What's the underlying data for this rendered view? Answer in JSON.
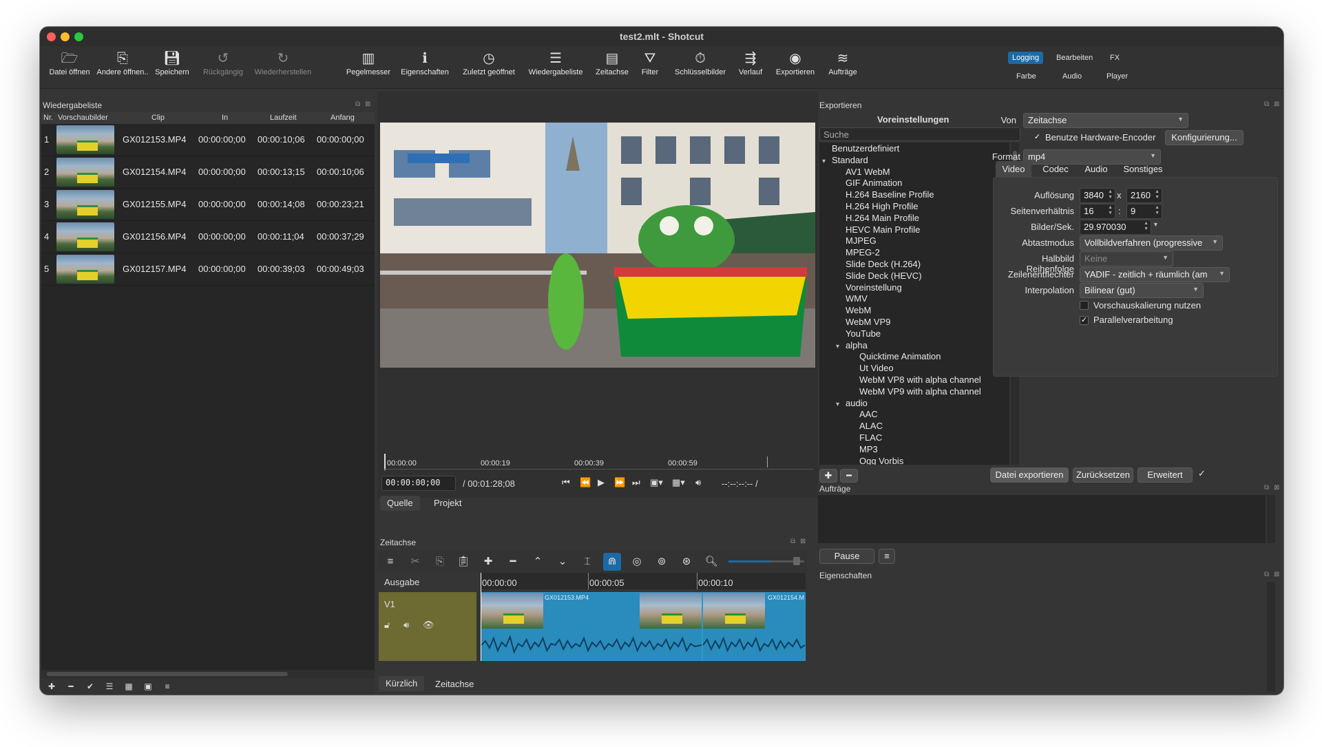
{
  "window": {
    "title": "test2.mlt - Shotcut"
  },
  "toolbar": {
    "items": [
      {
        "label": "Datei öffnen",
        "icon": "folder-open-icon"
      },
      {
        "label": "Andere öffnen..",
        "icon": "open-other-icon"
      },
      {
        "label": "Speichern",
        "icon": "save-icon"
      },
      {
        "label": "Rückgängig",
        "icon": "undo-icon"
      },
      {
        "label": "Wiederherstellen",
        "icon": "redo-icon"
      },
      {
        "label": "Pegelmesser",
        "icon": "peak-meter-icon"
      },
      {
        "label": "Eigenschaften",
        "icon": "info-icon"
      },
      {
        "label": "Zuletzt geöffnet",
        "icon": "clock-icon"
      },
      {
        "label": "Wiedergabeliste",
        "icon": "list-icon"
      },
      {
        "label": "Zeitachse",
        "icon": "timeline-icon"
      },
      {
        "label": "Filter",
        "icon": "filter-icon"
      },
      {
        "label": "Schlüsselbilder",
        "icon": "stopwatch-icon"
      },
      {
        "label": "Verlauf",
        "icon": "history-icon"
      },
      {
        "label": "Exportieren",
        "icon": "export-icon"
      },
      {
        "label": "Aufträge",
        "icon": "jobs-icon"
      }
    ],
    "layouts": {
      "logging": "Logging",
      "bearbeiten": "Bearbeiten",
      "fx": "FX",
      "farbe": "Farbe",
      "audio": "Audio",
      "player": "Player"
    }
  },
  "playlist": {
    "title": "Wiedergabeliste",
    "columns": {
      "nr": "Nr.",
      "thumbs": "Vorschaubilder",
      "clip": "Clip",
      "in": "In",
      "duration": "Laufzeit",
      "start": "Anfang"
    },
    "rows": [
      {
        "nr": "1",
        "clip": "GX012153.MP4",
        "in": "00:00:00;00",
        "duration": "00:00:10;06",
        "start": "00:00:00;00"
      },
      {
        "nr": "2",
        "clip": "GX012154.MP4",
        "in": "00:00:00;00",
        "duration": "00:00:13;15",
        "start": "00:00:10;06"
      },
      {
        "nr": "3",
        "clip": "GX012155.MP4",
        "in": "00:00:00;00",
        "duration": "00:00:14;08",
        "start": "00:00:23;21"
      },
      {
        "nr": "4",
        "clip": "GX012156.MP4",
        "in": "00:00:00;00",
        "duration": "00:00:11;04",
        "start": "00:00:37;29"
      },
      {
        "nr": "5",
        "clip": "GX012157.MP4",
        "in": "00:00:00;00",
        "duration": "00:00:39;03",
        "start": "00:00:49;03"
      }
    ]
  },
  "player": {
    "ruler": [
      "00:00:00",
      "00:00:19",
      "00:00:39",
      "00:00:59"
    ],
    "timecode": "00:00:00;00",
    "total": "/ 00:01:28;08",
    "in_out": "--:--:--:-- /",
    "tabs": {
      "source": "Quelle",
      "project": "Projekt"
    }
  },
  "timeline": {
    "title": "Zeitachse",
    "output": "Ausgabe",
    "track": "V1",
    "ruler": [
      "00:00:00",
      "00:00:05",
      "00:00:10"
    ],
    "clip1": "GX012153.MP4",
    "clip2": "GX012154.M",
    "bottom_tabs": {
      "recent": "Kürzlich",
      "timeline": "Zeitachse"
    }
  },
  "export": {
    "title": "Exportieren",
    "presets_title": "Voreinstellungen",
    "search_placeholder": "Suche",
    "presets": [
      {
        "label": "Benutzerdefiniert",
        "level": 0,
        "arrow": ""
      },
      {
        "label": "Standard",
        "level": 0,
        "arrow": "▾"
      },
      {
        "label": "AV1 WebM",
        "level": 1,
        "arrow": ""
      },
      {
        "label": "GIF Animation",
        "level": 1,
        "arrow": ""
      },
      {
        "label": "H.264 Baseline Profile",
        "level": 1,
        "arrow": ""
      },
      {
        "label": "H.264 High Profile",
        "level": 1,
        "arrow": ""
      },
      {
        "label": "H.264 Main Profile",
        "level": 1,
        "arrow": ""
      },
      {
        "label": "HEVC Main Profile",
        "level": 1,
        "arrow": ""
      },
      {
        "label": "MJPEG",
        "level": 1,
        "arrow": ""
      },
      {
        "label": "MPEG-2",
        "level": 1,
        "arrow": ""
      },
      {
        "label": "Slide Deck (H.264)",
        "level": 1,
        "arrow": ""
      },
      {
        "label": "Slide Deck (HEVC)",
        "level": 1,
        "arrow": ""
      },
      {
        "label": "Voreinstellung",
        "level": 1,
        "arrow": ""
      },
      {
        "label": "WMV",
        "level": 1,
        "arrow": ""
      },
      {
        "label": "WebM",
        "level": 1,
        "arrow": ""
      },
      {
        "label": "WebM VP9",
        "level": 1,
        "arrow": ""
      },
      {
        "label": "YouTube",
        "level": 1,
        "arrow": ""
      },
      {
        "label": "alpha",
        "level": 1,
        "arrow": "▾"
      },
      {
        "label": "Quicktime Animation",
        "level": 2,
        "arrow": ""
      },
      {
        "label": "Ut Video",
        "level": 2,
        "arrow": ""
      },
      {
        "label": "WebM VP8 with alpha channel",
        "level": 2,
        "arrow": ""
      },
      {
        "label": "WebM VP9 with alpha channel",
        "level": 2,
        "arrow": ""
      },
      {
        "label": "audio",
        "level": 1,
        "arrow": "▾"
      },
      {
        "label": "AAC",
        "level": 2,
        "arrow": ""
      },
      {
        "label": "ALAC",
        "level": 2,
        "arrow": ""
      },
      {
        "label": "FLAC",
        "level": 2,
        "arrow": ""
      },
      {
        "label": "MP3",
        "level": 2,
        "arrow": ""
      },
      {
        "label": "Ogg Vorbis",
        "level": 2,
        "arrow": ""
      }
    ],
    "from_label": "Von",
    "from_value": "Zeitachse",
    "hw_encoder": "Benutze Hardware-Encoder",
    "configure": "Konfigurierung...",
    "format_label": "Format",
    "format_value": "mp4",
    "tabs": {
      "video": "Video",
      "codec": "Codec",
      "audio": "Audio",
      "other": "Sonstiges"
    },
    "fields": {
      "resolution_label": "Auflösung",
      "width": "3840",
      "x": "x",
      "height": "2160",
      "aspect_label": "Seitenverhältnis",
      "aspect_w": "16",
      "colon": ":",
      "aspect_h": "9",
      "fps_label": "Bilder/Sek.",
      "fps": "29.970030",
      "scan_label": "Abtastmodus",
      "scan": "Vollbildverfahren (progressive",
      "field_order_label": "Halbbild Reihenfolge",
      "field_order": "Keine",
      "deinterlacer_label": "Zeilenentflechter",
      "deinterlacer": "YADIF - zeitlich + räumlich (am",
      "interp_label": "Interpolation",
      "interp": "Bilinear (gut)",
      "preview_scale": "Vorschauskalierung nutzen",
      "parallel": "Parallelverarbeitung"
    },
    "buttons": {
      "export": "Datei exportieren",
      "reset": "Zurücksetzen",
      "advanced": "Erweitert"
    }
  },
  "jobs": {
    "title": "Aufträge",
    "pause": "Pause"
  },
  "properties": {
    "title": "Eigenschaften"
  },
  "colors": {
    "accent": "#1b6aa5",
    "track_head": "#6d6a32",
    "clip": "#2a8bbd"
  }
}
